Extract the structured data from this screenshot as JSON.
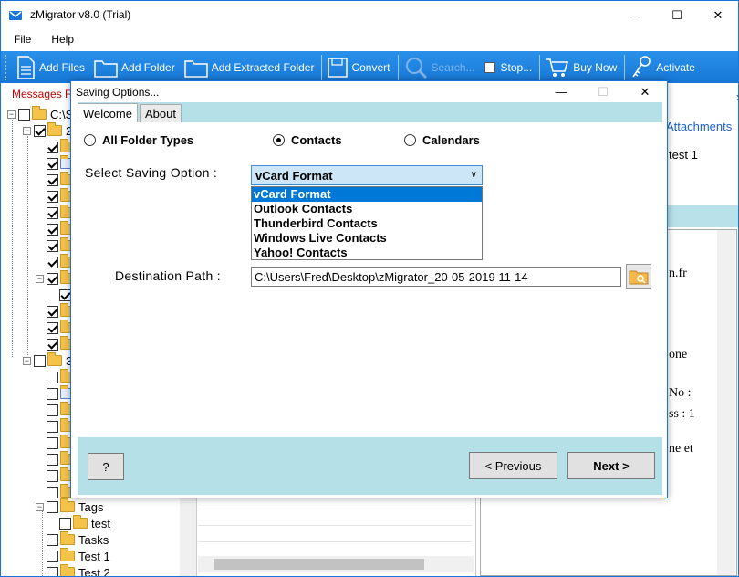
{
  "app": {
    "title": "zMigrator v8.0 (Trial)",
    "window_controls": {
      "minimize": "—",
      "maximize": "☐",
      "close": "✕"
    }
  },
  "menu": {
    "items": [
      "File",
      "Help"
    ]
  },
  "toolbar": {
    "add_files": "Add Files",
    "add_folder": "Add Folder",
    "add_extracted_folder": "Add Extracted Folder",
    "convert": "Convert",
    "search": "Search...",
    "stop": "Stop...",
    "buy_now": "Buy Now",
    "activate": "Activate"
  },
  "left_panel": {
    "header": "Messages Fo",
    "root": "C:\\S",
    "node2": "2.",
    "node3": "3.",
    "tags": "Tags",
    "test": "test",
    "tasks": "Tasks",
    "test1": "Test 1",
    "test2": "Test 2"
  },
  "right_panel": {
    "attachments": "Attachments",
    "subject": "test 1",
    "body_lines": [
      "n.fr",
      "one",
      "No :",
      "ss : 1",
      "ne et"
    ]
  },
  "dialog": {
    "title": "Saving Options...",
    "tabs": [
      "Welcome",
      "About"
    ],
    "radios": {
      "all_folder_types": "All Folder Types",
      "contacts": "Contacts",
      "calendars": "Calendars",
      "selected": "contacts"
    },
    "saving_option_label": "Select Saving Option :",
    "saving_option_value": "vCard Format",
    "saving_options": [
      "vCard Format",
      "Outlook Contacts",
      "Thunderbird Contacts",
      "Windows Live Contacts",
      "Yahoo! Contacts"
    ],
    "destination_label": "Destination Path :",
    "destination_value": "C:\\Users\\Fred\\Desktop\\zMigrator_20-05-2019 11-14",
    "help_button": "?",
    "previous_button": "<  Previous",
    "next_button": "Next >"
  }
}
